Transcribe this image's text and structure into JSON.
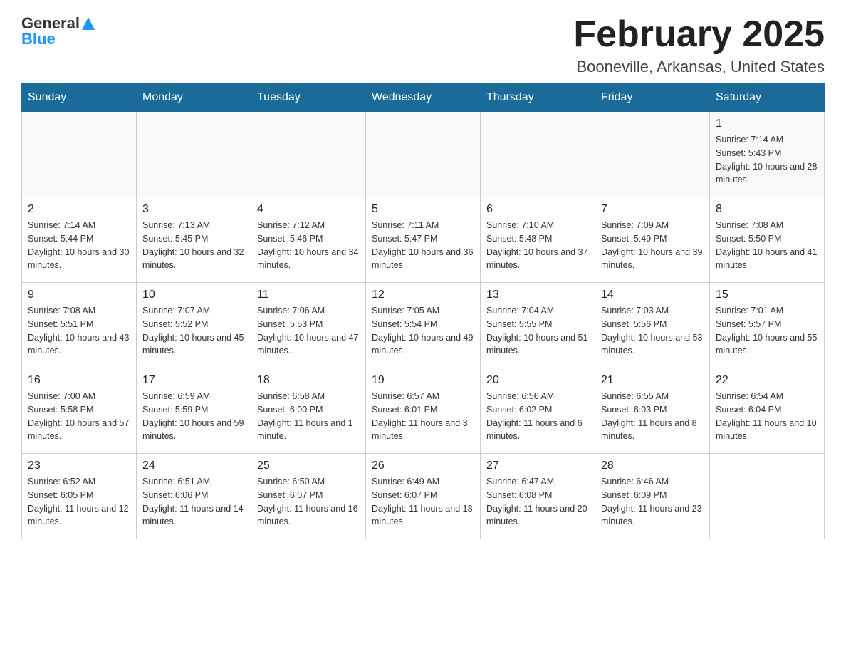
{
  "logo": {
    "general": "General",
    "blue": "Blue"
  },
  "header": {
    "month": "February 2025",
    "location": "Booneville, Arkansas, United States"
  },
  "days_of_week": [
    "Sunday",
    "Monday",
    "Tuesday",
    "Wednesday",
    "Thursday",
    "Friday",
    "Saturday"
  ],
  "weeks": [
    [
      {
        "day": "",
        "sunrise": "",
        "sunset": "",
        "daylight": ""
      },
      {
        "day": "",
        "sunrise": "",
        "sunset": "",
        "daylight": ""
      },
      {
        "day": "",
        "sunrise": "",
        "sunset": "",
        "daylight": ""
      },
      {
        "day": "",
        "sunrise": "",
        "sunset": "",
        "daylight": ""
      },
      {
        "day": "",
        "sunrise": "",
        "sunset": "",
        "daylight": ""
      },
      {
        "day": "",
        "sunrise": "",
        "sunset": "",
        "daylight": ""
      },
      {
        "day": "1",
        "sunrise": "Sunrise: 7:14 AM",
        "sunset": "Sunset: 5:43 PM",
        "daylight": "Daylight: 10 hours and 28 minutes."
      }
    ],
    [
      {
        "day": "2",
        "sunrise": "Sunrise: 7:14 AM",
        "sunset": "Sunset: 5:44 PM",
        "daylight": "Daylight: 10 hours and 30 minutes."
      },
      {
        "day": "3",
        "sunrise": "Sunrise: 7:13 AM",
        "sunset": "Sunset: 5:45 PM",
        "daylight": "Daylight: 10 hours and 32 minutes."
      },
      {
        "day": "4",
        "sunrise": "Sunrise: 7:12 AM",
        "sunset": "Sunset: 5:46 PM",
        "daylight": "Daylight: 10 hours and 34 minutes."
      },
      {
        "day": "5",
        "sunrise": "Sunrise: 7:11 AM",
        "sunset": "Sunset: 5:47 PM",
        "daylight": "Daylight: 10 hours and 36 minutes."
      },
      {
        "day": "6",
        "sunrise": "Sunrise: 7:10 AM",
        "sunset": "Sunset: 5:48 PM",
        "daylight": "Daylight: 10 hours and 37 minutes."
      },
      {
        "day": "7",
        "sunrise": "Sunrise: 7:09 AM",
        "sunset": "Sunset: 5:49 PM",
        "daylight": "Daylight: 10 hours and 39 minutes."
      },
      {
        "day": "8",
        "sunrise": "Sunrise: 7:08 AM",
        "sunset": "Sunset: 5:50 PM",
        "daylight": "Daylight: 10 hours and 41 minutes."
      }
    ],
    [
      {
        "day": "9",
        "sunrise": "Sunrise: 7:08 AM",
        "sunset": "Sunset: 5:51 PM",
        "daylight": "Daylight: 10 hours and 43 minutes."
      },
      {
        "day": "10",
        "sunrise": "Sunrise: 7:07 AM",
        "sunset": "Sunset: 5:52 PM",
        "daylight": "Daylight: 10 hours and 45 minutes."
      },
      {
        "day": "11",
        "sunrise": "Sunrise: 7:06 AM",
        "sunset": "Sunset: 5:53 PM",
        "daylight": "Daylight: 10 hours and 47 minutes."
      },
      {
        "day": "12",
        "sunrise": "Sunrise: 7:05 AM",
        "sunset": "Sunset: 5:54 PM",
        "daylight": "Daylight: 10 hours and 49 minutes."
      },
      {
        "day": "13",
        "sunrise": "Sunrise: 7:04 AM",
        "sunset": "Sunset: 5:55 PM",
        "daylight": "Daylight: 10 hours and 51 minutes."
      },
      {
        "day": "14",
        "sunrise": "Sunrise: 7:03 AM",
        "sunset": "Sunset: 5:56 PM",
        "daylight": "Daylight: 10 hours and 53 minutes."
      },
      {
        "day": "15",
        "sunrise": "Sunrise: 7:01 AM",
        "sunset": "Sunset: 5:57 PM",
        "daylight": "Daylight: 10 hours and 55 minutes."
      }
    ],
    [
      {
        "day": "16",
        "sunrise": "Sunrise: 7:00 AM",
        "sunset": "Sunset: 5:58 PM",
        "daylight": "Daylight: 10 hours and 57 minutes."
      },
      {
        "day": "17",
        "sunrise": "Sunrise: 6:59 AM",
        "sunset": "Sunset: 5:59 PM",
        "daylight": "Daylight: 10 hours and 59 minutes."
      },
      {
        "day": "18",
        "sunrise": "Sunrise: 6:58 AM",
        "sunset": "Sunset: 6:00 PM",
        "daylight": "Daylight: 11 hours and 1 minute."
      },
      {
        "day": "19",
        "sunrise": "Sunrise: 6:57 AM",
        "sunset": "Sunset: 6:01 PM",
        "daylight": "Daylight: 11 hours and 3 minutes."
      },
      {
        "day": "20",
        "sunrise": "Sunrise: 6:56 AM",
        "sunset": "Sunset: 6:02 PM",
        "daylight": "Daylight: 11 hours and 6 minutes."
      },
      {
        "day": "21",
        "sunrise": "Sunrise: 6:55 AM",
        "sunset": "Sunset: 6:03 PM",
        "daylight": "Daylight: 11 hours and 8 minutes."
      },
      {
        "day": "22",
        "sunrise": "Sunrise: 6:54 AM",
        "sunset": "Sunset: 6:04 PM",
        "daylight": "Daylight: 11 hours and 10 minutes."
      }
    ],
    [
      {
        "day": "23",
        "sunrise": "Sunrise: 6:52 AM",
        "sunset": "Sunset: 6:05 PM",
        "daylight": "Daylight: 11 hours and 12 minutes."
      },
      {
        "day": "24",
        "sunrise": "Sunrise: 6:51 AM",
        "sunset": "Sunset: 6:06 PM",
        "daylight": "Daylight: 11 hours and 14 minutes."
      },
      {
        "day": "25",
        "sunrise": "Sunrise: 6:50 AM",
        "sunset": "Sunset: 6:07 PM",
        "daylight": "Daylight: 11 hours and 16 minutes."
      },
      {
        "day": "26",
        "sunrise": "Sunrise: 6:49 AM",
        "sunset": "Sunset: 6:07 PM",
        "daylight": "Daylight: 11 hours and 18 minutes."
      },
      {
        "day": "27",
        "sunrise": "Sunrise: 6:47 AM",
        "sunset": "Sunset: 6:08 PM",
        "daylight": "Daylight: 11 hours and 20 minutes."
      },
      {
        "day": "28",
        "sunrise": "Sunrise: 6:46 AM",
        "sunset": "Sunset: 6:09 PM",
        "daylight": "Daylight: 11 hours and 23 minutes."
      },
      {
        "day": "",
        "sunrise": "",
        "sunset": "",
        "daylight": ""
      }
    ]
  ]
}
